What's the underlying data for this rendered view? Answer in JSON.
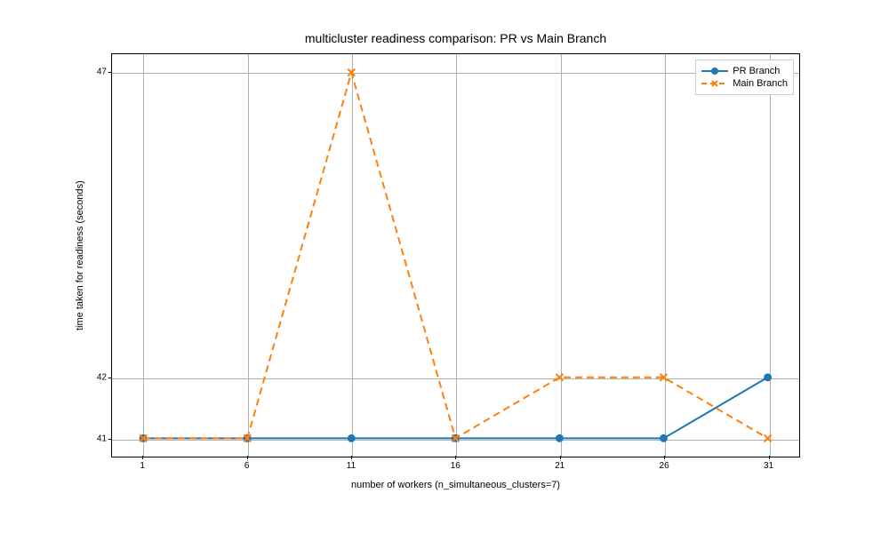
{
  "chart_data": {
    "type": "line",
    "title": "multicluster readiness comparison: PR vs Main Branch",
    "xlabel": "number of workers (n_simultaneous_clusters=7)",
    "ylabel": "time taken for readiness (seconds)",
    "x": [
      1,
      6,
      11,
      16,
      21,
      26,
      31
    ],
    "series": [
      {
        "name": "PR Branch",
        "values": [
          41,
          41,
          41,
          41,
          41,
          41,
          42
        ],
        "color": "#1f77b4",
        "style": "solid",
        "marker": "circle"
      },
      {
        "name": "Main Branch",
        "values": [
          41,
          41,
          47,
          41,
          42,
          42,
          41
        ],
        "color": "#ff7f0e",
        "style": "dashed",
        "marker": "x"
      }
    ],
    "yticks": [
      41,
      42,
      47
    ],
    "xticks": [
      1,
      6,
      11,
      16,
      21,
      26,
      31
    ],
    "ylim": [
      40.7,
      47.3
    ],
    "xlim": [
      -0.5,
      32.5
    ]
  },
  "colors": {
    "pr": "#1f77b4",
    "main": "#ff7f0e"
  }
}
